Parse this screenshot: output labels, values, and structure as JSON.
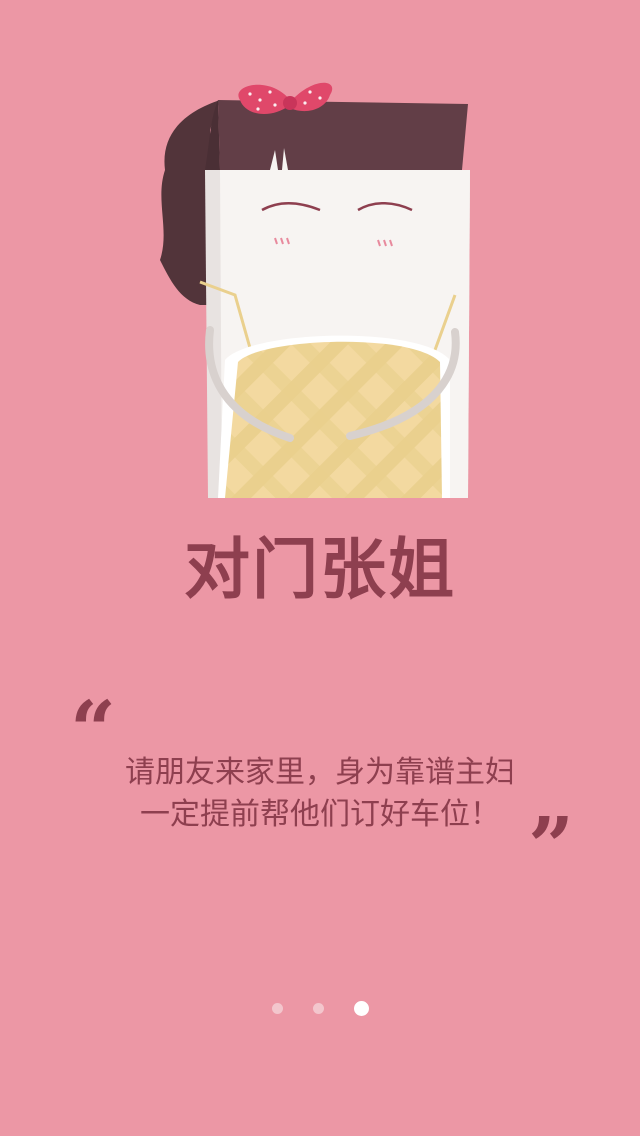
{
  "colors": {
    "background": "#ec97a5",
    "accent": "#8e3f4f",
    "dot_inactive": "#f3c6cd",
    "dot_active": "#ffffff"
  },
  "illustration": {
    "icon": "housewife-character-illustration"
  },
  "title": "对门张姐",
  "quote": {
    "open_mark": "“",
    "close_mark": "”",
    "lines": [
      "请朋友来家里，身为靠谱主妇",
      "一定提前帮他们订好车位！"
    ]
  },
  "pager": {
    "total": 3,
    "current": 3
  }
}
